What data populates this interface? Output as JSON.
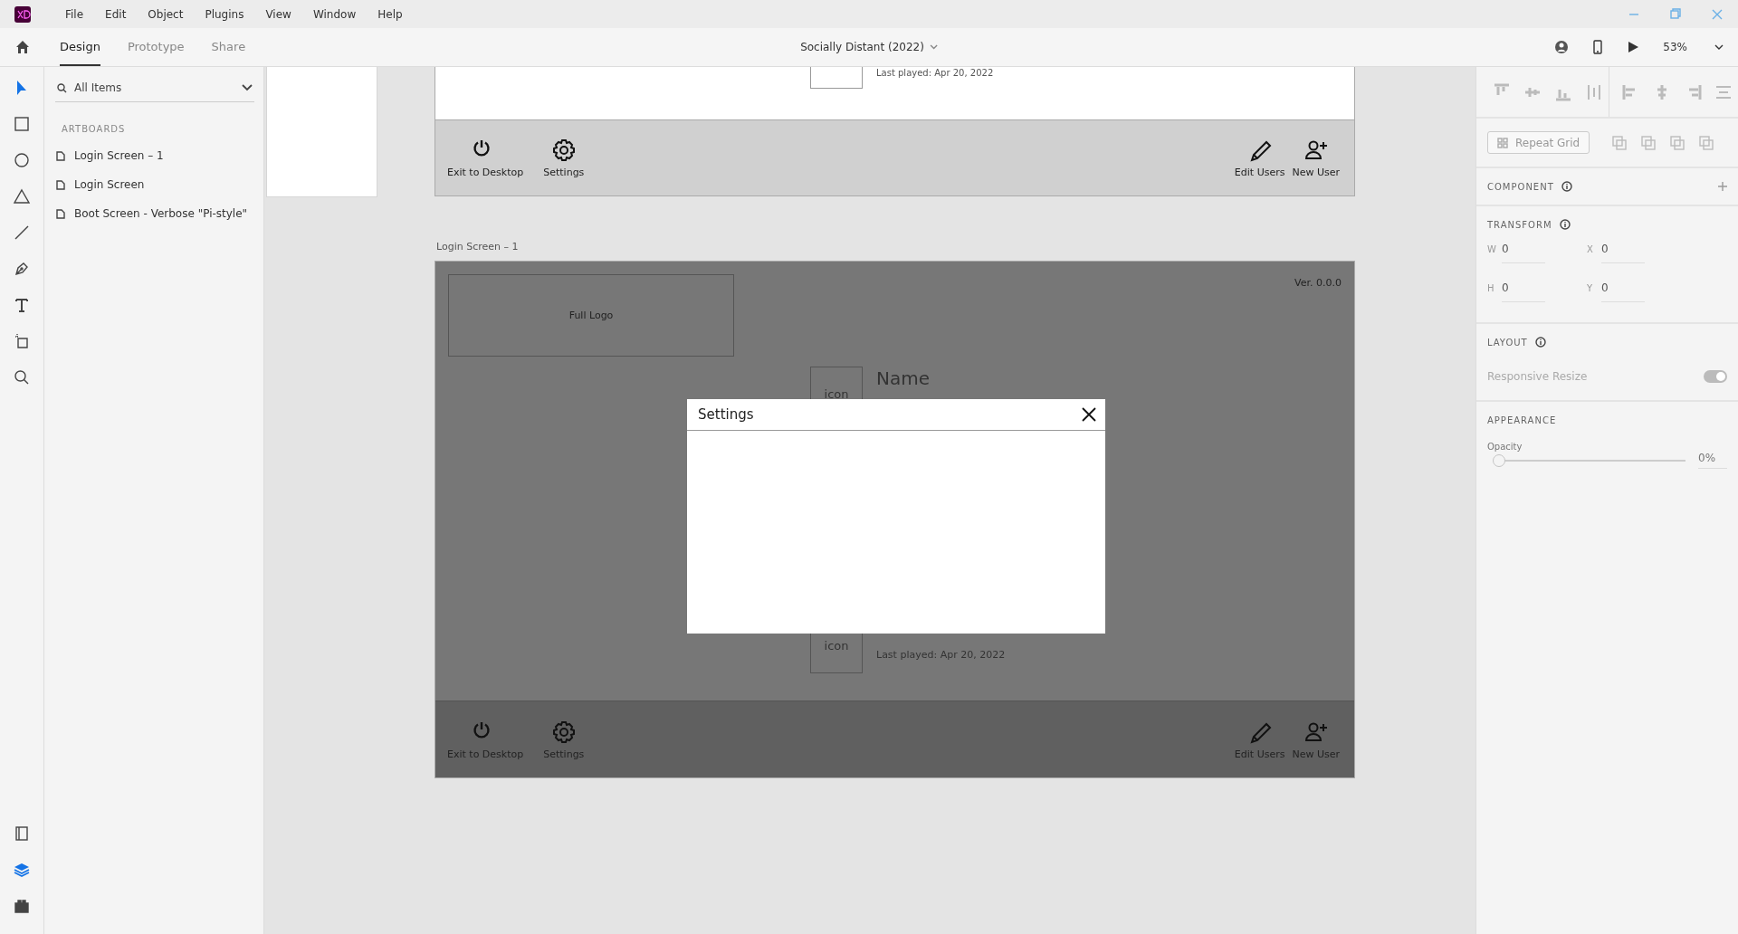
{
  "menu_bar": {
    "items": [
      "File",
      "Edit",
      "Object",
      "Plugins",
      "View",
      "Window",
      "Help"
    ]
  },
  "header": {
    "tabs": [
      {
        "label": "Design",
        "selected": true
      },
      {
        "label": "Prototype",
        "selected": false
      },
      {
        "label": "Share",
        "selected": false
      }
    ],
    "document_title": "Socially Distant (2022)",
    "zoom": "53%"
  },
  "tools": [
    {
      "kind": "select",
      "selected": true
    },
    {
      "kind": "rectangle",
      "selected": false
    },
    {
      "kind": "ellipse",
      "selected": false
    },
    {
      "kind": "triangle",
      "selected": false
    },
    {
      "kind": "line",
      "selected": false
    },
    {
      "kind": "pen",
      "selected": false
    },
    {
      "kind": "text",
      "selected": false
    },
    {
      "kind": "artboard",
      "selected": false
    },
    {
      "kind": "zoom",
      "selected": false
    }
  ],
  "panel_tabs": [
    {
      "kind": "assets",
      "selected": false
    },
    {
      "kind": "layers",
      "selected": true
    },
    {
      "kind": "plugins",
      "selected": false
    }
  ],
  "layers_panel": {
    "filter": "All Items",
    "section": "ARTBOARDS",
    "items": [
      "Login Screen – 1",
      "Login Screen",
      "Boot Screen - Verbose \"Pi-style\""
    ]
  },
  "top_artboard": {
    "last_played": "Last played: Apr 20, 2022",
    "toolbar_left": [
      {
        "kind": "power",
        "label": "Exit to Desktop"
      },
      {
        "kind": "gear",
        "label": "Settings"
      }
    ],
    "toolbar_right": [
      {
        "kind": "pencil",
        "label": "Edit Users"
      },
      {
        "kind": "add-user",
        "label": "New User"
      }
    ]
  },
  "login_artboard": {
    "title": "Login Screen – 1",
    "logo": "Full Logo",
    "version": "Ver. 0.0.0",
    "users": [
      {
        "icon": "icon",
        "name": "Name"
      },
      {
        "icon": "icon",
        "last_played": "Last played: Apr 20, 2022"
      }
    ],
    "toolbar_left": [
      {
        "kind": "power",
        "label": "Exit to Desktop"
      },
      {
        "kind": "gear",
        "label": "Settings"
      }
    ],
    "toolbar_right": [
      {
        "kind": "pencil",
        "label": "Edit Users"
      },
      {
        "kind": "add-user",
        "label": "New User"
      }
    ],
    "dialog": {
      "title": "Settings"
    }
  },
  "properties": {
    "repeat_grid": "Repeat Grid",
    "component": "COMPONENT",
    "transform": {
      "heading": "TRANSFORM",
      "fields": [
        {
          "label": "W",
          "value": "0"
        },
        {
          "label": "X",
          "value": "0"
        },
        {
          "label": "H",
          "value": "0"
        },
        {
          "label": "Y",
          "value": "0"
        }
      ]
    },
    "layout": {
      "heading": "LAYOUT",
      "responsive_label": "Responsive Resize",
      "responsive_on": true
    },
    "appearance": {
      "heading": "APPEARANCE",
      "opacity": {
        "label": "Opacity",
        "level": 0,
        "value": "0%"
      }
    }
  }
}
